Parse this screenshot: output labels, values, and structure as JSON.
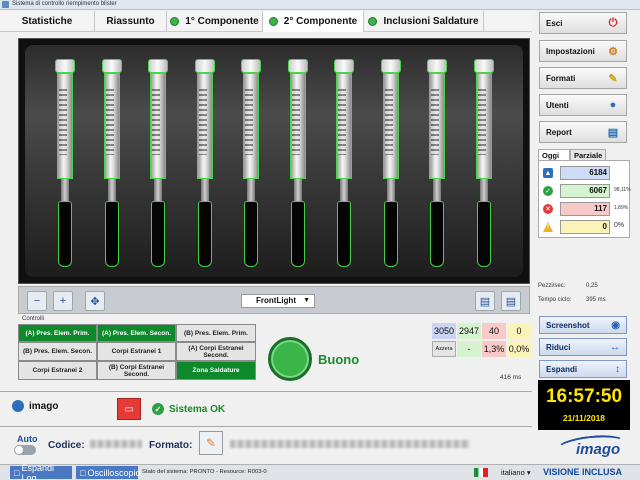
{
  "window": {
    "title": "Sistema di controllo riempimento blister"
  },
  "tabs": [
    {
      "label": "Statistiche",
      "dot": false
    },
    {
      "label": "Riassunto",
      "dot": false
    },
    {
      "label": "1° Componente",
      "dot": true
    },
    {
      "label": "2° Componente",
      "dot": true,
      "active": true
    },
    {
      "label": "Inclusioni Saldature",
      "dot": true
    }
  ],
  "viewer": {
    "light_select": "FrontLight",
    "tools": [
      "zoom-out-icon",
      "zoom-in-icon",
      "fit-icon",
      "save-image-icon",
      "save-all-icon"
    ],
    "tube_count": 10
  },
  "controls": {
    "title": "Controlli",
    "cells": [
      {
        "label": "(A) Pres. Elem. Prim.",
        "state": "ok"
      },
      {
        "label": "(A) Pres. Elem. Secon.",
        "state": "ok"
      },
      {
        "label": "(B) Pres. Elem. Prim.",
        "state": "off"
      },
      {
        "label": "(B) Pres. Elem. Secon.",
        "state": "off"
      },
      {
        "label": "Corpi Estranei 1",
        "state": "off"
      },
      {
        "label": "(A) Corpi Estranei Second.",
        "state": "off"
      },
      {
        "label": "Corpi Estranei 2",
        "state": "off"
      },
      {
        "label": "(B) Corpi Estranei Second.",
        "state": "off"
      },
      {
        "label": "Zona Saldature",
        "state": "ok"
      }
    ]
  },
  "result": {
    "text": "Buono",
    "color": "#1c8a2d"
  },
  "counts": {
    "values": [
      "3050",
      "2947",
      "40",
      "0"
    ],
    "reset_label": "Azzera",
    "pcts": [
      "-",
      "1,3%",
      "0,0%"
    ],
    "time": "416 ms"
  },
  "user": {
    "name": "imago"
  },
  "system_status": "Sistema OK",
  "auto_label": "Auto",
  "code_label": "Codice:",
  "format_label": "Formato:",
  "statusbar": {
    "expand_log": "Espandi Log",
    "oscilloscope": "Oscilloscopio",
    "status_text": "Stato del sistema: PRONTO - Resource: R003-0",
    "language": "italiano",
    "edition": "VISIONE INCLUSA"
  },
  "side": {
    "buttons": [
      {
        "label": "Esci",
        "icon": "power-icon"
      },
      {
        "label": "Impostazioni",
        "icon": "settings-icon"
      },
      {
        "label": "Formati",
        "icon": "formats-icon"
      },
      {
        "label": "Utenti",
        "icon": "users-icon"
      },
      {
        "label": "Report",
        "icon": "report-icon"
      }
    ],
    "tabs": [
      "Oggi",
      "Parziale"
    ],
    "rows": [
      {
        "value": "6184",
        "pct": "",
        "color": "#cfdcf7"
      },
      {
        "value": "6067",
        "pct": "98,11%",
        "color": "#d5f3cf"
      },
      {
        "value": "117",
        "pct": "1,89%",
        "color": "#f8c9c9"
      },
      {
        "value": "0",
        "pct": "0%",
        "color": "#fbf3b8"
      }
    ],
    "pieces_label": "Pezzi/sec:",
    "pieces_value": "0,25",
    "cycle_label": "Tempo ciclo:",
    "cycle_value": "395 ms",
    "screenshot": "Screenshot",
    "reduce": "Riduci",
    "expand": "Espandi",
    "time": "16:57:50",
    "date": "21/11/2018",
    "logo": "imago"
  }
}
